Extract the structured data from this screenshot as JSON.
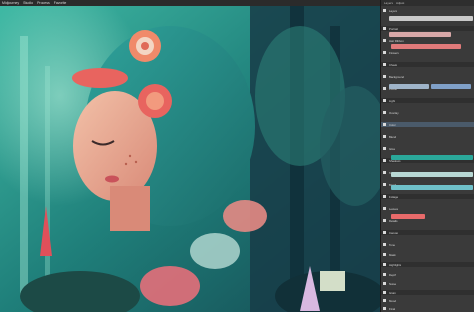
{
  "menu": {
    "items": [
      "Midjourney",
      "Studio",
      "Process",
      "Favorite"
    ]
  },
  "panel": {
    "tabs": [
      "Layers",
      "Adjust"
    ],
    "rows": [
      {
        "label": "Layers"
      },
      {
        "label": "Portrait"
      },
      {
        "label": "Hair Ribbon"
      },
      {
        "label": "Flowers"
      },
      {
        "label": "Cheek"
      },
      {
        "label": "Background"
      },
      {
        "label": "Forest"
      },
      {
        "label": "Light"
      },
      {
        "label": "Overlay"
      },
      {
        "label": "Color"
      },
      {
        "label": "Blend"
      },
      {
        "label": "Glow"
      },
      {
        "label": "Shadows"
      },
      {
        "label": "Texture"
      },
      {
        "label": "Brush"
      },
      {
        "label": "Foliage"
      },
      {
        "label": "Leaves"
      },
      {
        "label": "Details"
      },
      {
        "label": "Canvas"
      },
      {
        "label": "Tone"
      },
      {
        "label": "Mask"
      },
      {
        "label": "Highlights"
      },
      {
        "label": "Depth"
      },
      {
        "label": "Noise"
      },
      {
        "label": "Grain"
      },
      {
        "label": "Mood"
      },
      {
        "label": "Final"
      }
    ]
  },
  "colors": {
    "panel_bg": "#3a3a3a",
    "accent_teal": "#2aa89a",
    "accent_pink": "#e86a6a",
    "accent_blue": "#7fa0c8"
  }
}
